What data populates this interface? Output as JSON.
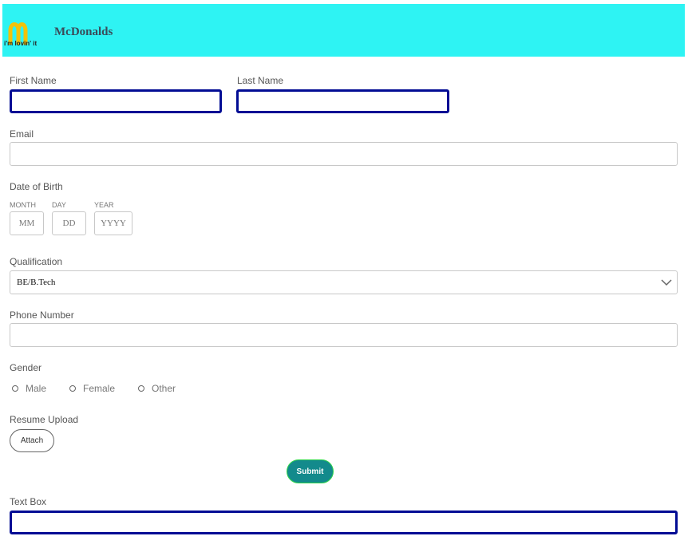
{
  "header": {
    "logo_icon": "mcdonalds-golden-arches-icon",
    "tagline": "i'm lovin' it",
    "brand": "McDonalds",
    "background": "#2ef3f3"
  },
  "form": {
    "first_name": {
      "label": "First Name",
      "value": ""
    },
    "last_name": {
      "label": "Last Name",
      "value": ""
    },
    "email": {
      "label": "Email",
      "value": ""
    },
    "dob": {
      "label": "Date of Birth",
      "month_label": "MONTH",
      "month_placeholder": "MM",
      "day_label": "DAY",
      "day_placeholder": "DD",
      "year_label": "YEAR",
      "year_placeholder": "YYYY"
    },
    "qualification": {
      "label": "Qualification",
      "selected": "BE/B.Tech",
      "icon": "chevron-down-icon"
    },
    "phone": {
      "label": "Phone Number",
      "value": ""
    },
    "gender": {
      "label": "Gender",
      "options": [
        {
          "label": "Male",
          "checked": false
        },
        {
          "label": "Female",
          "checked": false
        },
        {
          "label": "Other",
          "checked": false
        }
      ]
    },
    "resume": {
      "label": "Resume Upload",
      "button": "Attach"
    },
    "submit": {
      "label": "Submit",
      "color": "#138a8c"
    },
    "text_box": {
      "label": "Text Box",
      "value": ""
    }
  },
  "colors": {
    "focus_border": "#020c94",
    "border": "#c8c8c8"
  }
}
